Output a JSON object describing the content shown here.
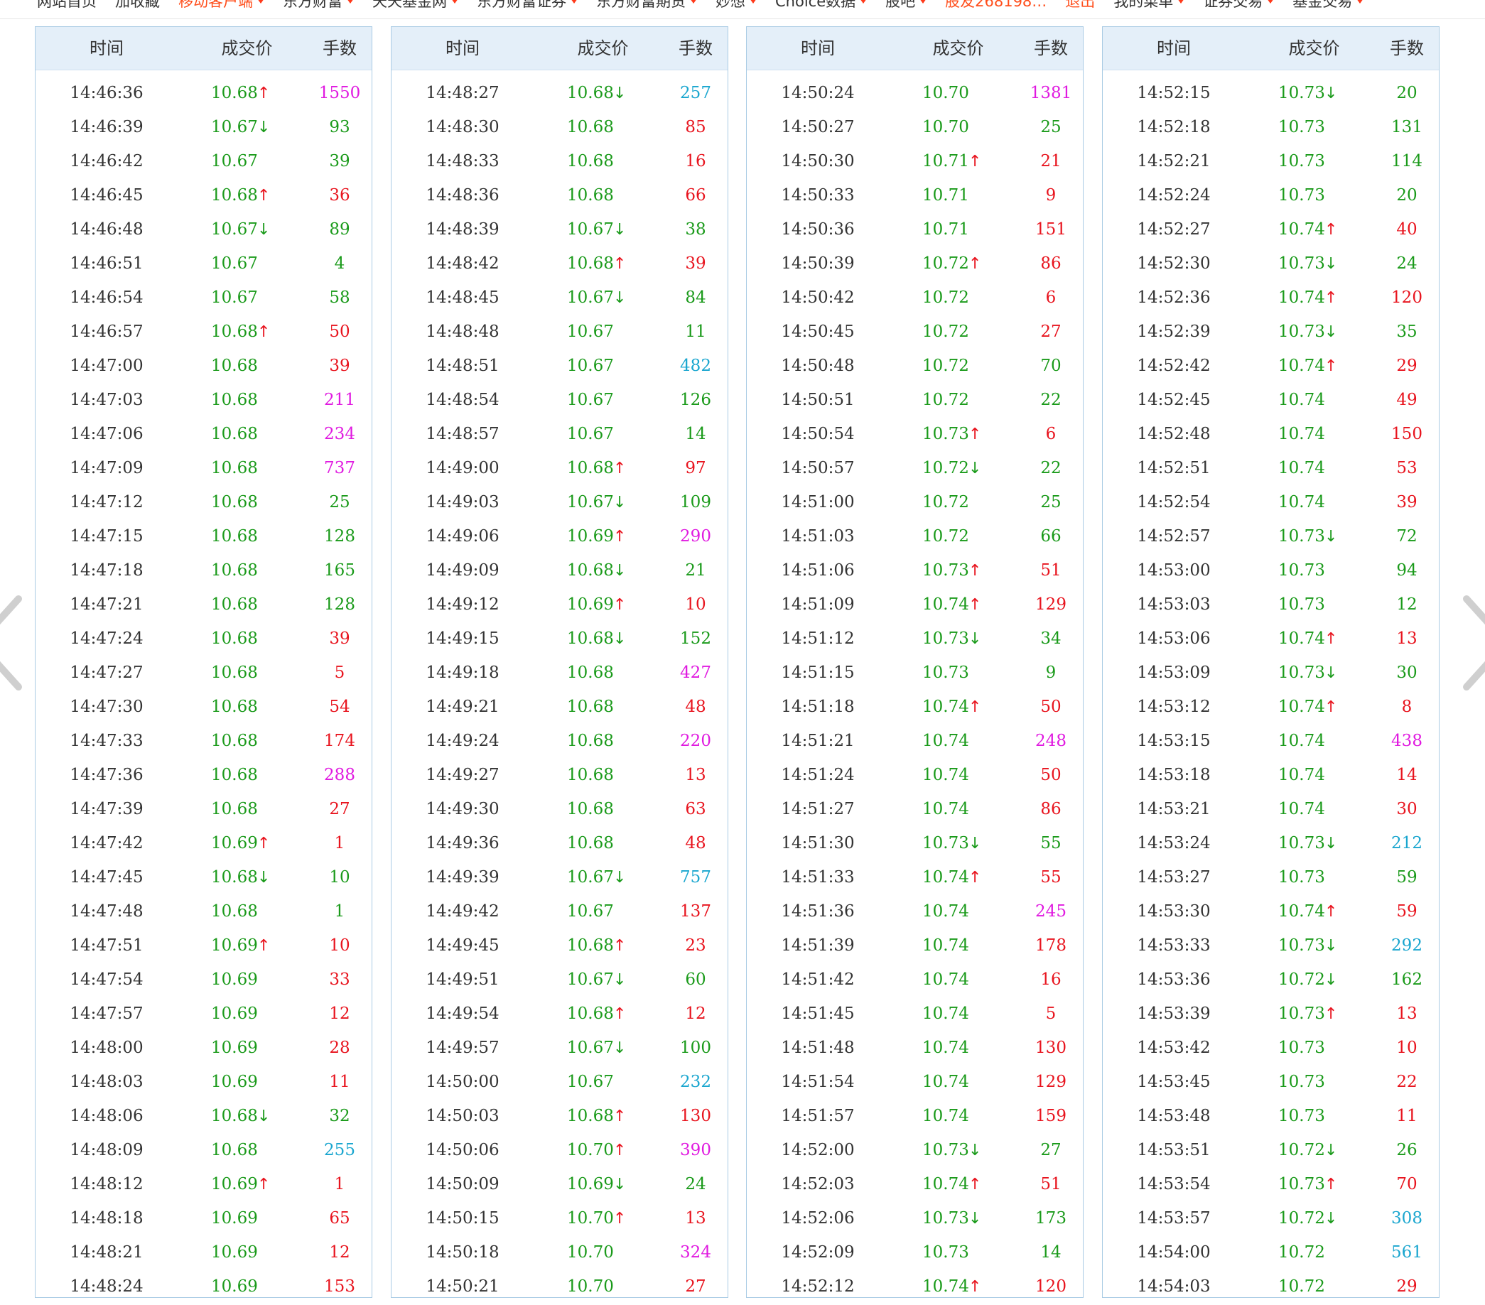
{
  "nav": [
    {
      "label": "网站首页",
      "red": false,
      "caret": false
    },
    {
      "label": "加收藏",
      "red": false,
      "caret": false
    },
    {
      "label": "移动客户端",
      "red": true,
      "caret": true
    },
    {
      "label": "东方财富",
      "red": false,
      "caret": true
    },
    {
      "label": "天天基金网",
      "red": false,
      "caret": true
    },
    {
      "label": "东方财富证券",
      "red": false,
      "caret": true
    },
    {
      "label": "东方财富期货",
      "red": false,
      "caret": true
    },
    {
      "label": "妙想",
      "red": false,
      "caret": true
    },
    {
      "label": "Choice数据",
      "red": false,
      "caret": true
    },
    {
      "label": "股吧",
      "red": false,
      "caret": true
    },
    {
      "label": "股友268198…",
      "red": true,
      "caret": false
    },
    {
      "label": "退出",
      "red": true,
      "caret": false
    },
    {
      "label": "我的菜单",
      "red": false,
      "caret": true
    },
    {
      "label": "证券交易",
      "red": false,
      "caret": true
    },
    {
      "label": "基金交易",
      "red": false,
      "caret": true
    }
  ],
  "headers": {
    "time": "时间",
    "price": "成交价",
    "volume": "手数"
  },
  "panels": [
    {
      "rows": [
        [
          "14:46:36",
          "10.68",
          "up",
          "1550",
          "m"
        ],
        [
          "14:46:39",
          "10.67",
          "down",
          "93",
          "g"
        ],
        [
          "14:46:42",
          "10.67",
          "",
          "39",
          "g"
        ],
        [
          "14:46:45",
          "10.68",
          "up",
          "36",
          "r"
        ],
        [
          "14:46:48",
          "10.67",
          "down",
          "89",
          "g"
        ],
        [
          "14:46:51",
          "10.67",
          "",
          "4",
          "g"
        ],
        [
          "14:46:54",
          "10.67",
          "",
          "58",
          "g"
        ],
        [
          "14:46:57",
          "10.68",
          "up",
          "50",
          "r"
        ],
        [
          "14:47:00",
          "10.68",
          "",
          "39",
          "r"
        ],
        [
          "14:47:03",
          "10.68",
          "",
          "211",
          "m"
        ],
        [
          "14:47:06",
          "10.68",
          "",
          "234",
          "m"
        ],
        [
          "14:47:09",
          "10.68",
          "",
          "737",
          "m"
        ],
        [
          "14:47:12",
          "10.68",
          "",
          "25",
          "g"
        ],
        [
          "14:47:15",
          "10.68",
          "",
          "128",
          "g"
        ],
        [
          "14:47:18",
          "10.68",
          "",
          "165",
          "g"
        ],
        [
          "14:47:21",
          "10.68",
          "",
          "128",
          "g"
        ],
        [
          "14:47:24",
          "10.68",
          "",
          "39",
          "r"
        ],
        [
          "14:47:27",
          "10.68",
          "",
          "5",
          "r"
        ],
        [
          "14:47:30",
          "10.68",
          "",
          "54",
          "r"
        ],
        [
          "14:47:33",
          "10.68",
          "",
          "174",
          "r"
        ],
        [
          "14:47:36",
          "10.68",
          "",
          "288",
          "m"
        ],
        [
          "14:47:39",
          "10.68",
          "",
          "27",
          "r"
        ],
        [
          "14:47:42",
          "10.69",
          "up",
          "1",
          "r"
        ],
        [
          "14:47:45",
          "10.68",
          "down",
          "10",
          "g"
        ],
        [
          "14:47:48",
          "10.68",
          "",
          "1",
          "g"
        ],
        [
          "14:47:51",
          "10.69",
          "up",
          "10",
          "r"
        ],
        [
          "14:47:54",
          "10.69",
          "",
          "33",
          "r"
        ],
        [
          "14:47:57",
          "10.69",
          "",
          "12",
          "r"
        ],
        [
          "14:48:00",
          "10.69",
          "",
          "28",
          "r"
        ],
        [
          "14:48:03",
          "10.69",
          "",
          "11",
          "r"
        ],
        [
          "14:48:06",
          "10.68",
          "down",
          "32",
          "g"
        ],
        [
          "14:48:09",
          "10.68",
          "",
          "255",
          "c"
        ],
        [
          "14:48:12",
          "10.69",
          "up",
          "1",
          "r"
        ],
        [
          "14:48:18",
          "10.69",
          "",
          "65",
          "r"
        ],
        [
          "14:48:21",
          "10.69",
          "",
          "12",
          "r"
        ],
        [
          "14:48:24",
          "10.69",
          "",
          "153",
          "r"
        ]
      ]
    },
    {
      "rows": [
        [
          "14:48:27",
          "10.68",
          "down",
          "257",
          "c"
        ],
        [
          "14:48:30",
          "10.68",
          "",
          "85",
          "r"
        ],
        [
          "14:48:33",
          "10.68",
          "",
          "16",
          "r"
        ],
        [
          "14:48:36",
          "10.68",
          "",
          "66",
          "r"
        ],
        [
          "14:48:39",
          "10.67",
          "down",
          "38",
          "g"
        ],
        [
          "14:48:42",
          "10.68",
          "up",
          "39",
          "r"
        ],
        [
          "14:48:45",
          "10.67",
          "down",
          "84",
          "g"
        ],
        [
          "14:48:48",
          "10.67",
          "",
          "11",
          "g"
        ],
        [
          "14:48:51",
          "10.67",
          "",
          "482",
          "c"
        ],
        [
          "14:48:54",
          "10.67",
          "",
          "126",
          "g"
        ],
        [
          "14:48:57",
          "10.67",
          "",
          "14",
          "g"
        ],
        [
          "14:49:00",
          "10.68",
          "up",
          "97",
          "r"
        ],
        [
          "14:49:03",
          "10.67",
          "down",
          "109",
          "g"
        ],
        [
          "14:49:06",
          "10.69",
          "up",
          "290",
          "m"
        ],
        [
          "14:49:09",
          "10.68",
          "down",
          "21",
          "g"
        ],
        [
          "14:49:12",
          "10.69",
          "up",
          "10",
          "r"
        ],
        [
          "14:49:15",
          "10.68",
          "down",
          "152",
          "g"
        ],
        [
          "14:49:18",
          "10.68",
          "",
          "427",
          "m"
        ],
        [
          "14:49:21",
          "10.68",
          "",
          "48",
          "r"
        ],
        [
          "14:49:24",
          "10.68",
          "",
          "220",
          "m"
        ],
        [
          "14:49:27",
          "10.68",
          "",
          "13",
          "r"
        ],
        [
          "14:49:30",
          "10.68",
          "",
          "63",
          "r"
        ],
        [
          "14:49:36",
          "10.68",
          "",
          "48",
          "r"
        ],
        [
          "14:49:39",
          "10.67",
          "down",
          "757",
          "c"
        ],
        [
          "14:49:42",
          "10.67",
          "",
          "137",
          "r"
        ],
        [
          "14:49:45",
          "10.68",
          "up",
          "23",
          "r"
        ],
        [
          "14:49:51",
          "10.67",
          "down",
          "60",
          "g"
        ],
        [
          "14:49:54",
          "10.68",
          "up",
          "12",
          "r"
        ],
        [
          "14:49:57",
          "10.67",
          "down",
          "100",
          "g"
        ],
        [
          "14:50:00",
          "10.67",
          "",
          "232",
          "c"
        ],
        [
          "14:50:03",
          "10.68",
          "up",
          "130",
          "r"
        ],
        [
          "14:50:06",
          "10.70",
          "up",
          "390",
          "m"
        ],
        [
          "14:50:09",
          "10.69",
          "down",
          "24",
          "g"
        ],
        [
          "14:50:15",
          "10.70",
          "up",
          "13",
          "r"
        ],
        [
          "14:50:18",
          "10.70",
          "",
          "324",
          "m"
        ],
        [
          "14:50:21",
          "10.70",
          "",
          "27",
          "r"
        ]
      ]
    },
    {
      "rows": [
        [
          "14:50:24",
          "10.70",
          "",
          "1381",
          "m"
        ],
        [
          "14:50:27",
          "10.70",
          "",
          "25",
          "g"
        ],
        [
          "14:50:30",
          "10.71",
          "up",
          "21",
          "r"
        ],
        [
          "14:50:33",
          "10.71",
          "",
          "9",
          "r"
        ],
        [
          "14:50:36",
          "10.71",
          "",
          "151",
          "r"
        ],
        [
          "14:50:39",
          "10.72",
          "up",
          "86",
          "r"
        ],
        [
          "14:50:42",
          "10.72",
          "",
          "6",
          "r"
        ],
        [
          "14:50:45",
          "10.72",
          "",
          "27",
          "r"
        ],
        [
          "14:50:48",
          "10.72",
          "",
          "70",
          "g"
        ],
        [
          "14:50:51",
          "10.72",
          "",
          "22",
          "g"
        ],
        [
          "14:50:54",
          "10.73",
          "up",
          "6",
          "r"
        ],
        [
          "14:50:57",
          "10.72",
          "down",
          "22",
          "g"
        ],
        [
          "14:51:00",
          "10.72",
          "",
          "25",
          "g"
        ],
        [
          "14:51:03",
          "10.72",
          "",
          "66",
          "g"
        ],
        [
          "14:51:06",
          "10.73",
          "up",
          "51",
          "r"
        ],
        [
          "14:51:09",
          "10.74",
          "up",
          "129",
          "r"
        ],
        [
          "14:51:12",
          "10.73",
          "down",
          "34",
          "g"
        ],
        [
          "14:51:15",
          "10.73",
          "",
          "9",
          "g"
        ],
        [
          "14:51:18",
          "10.74",
          "up",
          "50",
          "r"
        ],
        [
          "14:51:21",
          "10.74",
          "",
          "248",
          "m"
        ],
        [
          "14:51:24",
          "10.74",
          "",
          "50",
          "r"
        ],
        [
          "14:51:27",
          "10.74",
          "",
          "86",
          "r"
        ],
        [
          "14:51:30",
          "10.73",
          "down",
          "55",
          "g"
        ],
        [
          "14:51:33",
          "10.74",
          "up",
          "55",
          "r"
        ],
        [
          "14:51:36",
          "10.74",
          "",
          "245",
          "m"
        ],
        [
          "14:51:39",
          "10.74",
          "",
          "178",
          "r"
        ],
        [
          "14:51:42",
          "10.74",
          "",
          "16",
          "r"
        ],
        [
          "14:51:45",
          "10.74",
          "",
          "5",
          "r"
        ],
        [
          "14:51:48",
          "10.74",
          "",
          "130",
          "r"
        ],
        [
          "14:51:54",
          "10.74",
          "",
          "129",
          "r"
        ],
        [
          "14:51:57",
          "10.74",
          "",
          "159",
          "r"
        ],
        [
          "14:52:00",
          "10.73",
          "down",
          "27",
          "g"
        ],
        [
          "14:52:03",
          "10.74",
          "up",
          "51",
          "r"
        ],
        [
          "14:52:06",
          "10.73",
          "down",
          "173",
          "g"
        ],
        [
          "14:52:09",
          "10.73",
          "",
          "14",
          "g"
        ],
        [
          "14:52:12",
          "10.74",
          "up",
          "120",
          "r"
        ]
      ]
    },
    {
      "rows": [
        [
          "14:52:15",
          "10.73",
          "down",
          "20",
          "g"
        ],
        [
          "14:52:18",
          "10.73",
          "",
          "131",
          "g"
        ],
        [
          "14:52:21",
          "10.73",
          "",
          "114",
          "g"
        ],
        [
          "14:52:24",
          "10.73",
          "",
          "20",
          "g"
        ],
        [
          "14:52:27",
          "10.74",
          "up",
          "40",
          "r"
        ],
        [
          "14:52:30",
          "10.73",
          "down",
          "24",
          "g"
        ],
        [
          "14:52:36",
          "10.74",
          "up",
          "120",
          "r"
        ],
        [
          "14:52:39",
          "10.73",
          "down",
          "35",
          "g"
        ],
        [
          "14:52:42",
          "10.74",
          "up",
          "29",
          "r"
        ],
        [
          "14:52:45",
          "10.74",
          "",
          "49",
          "r"
        ],
        [
          "14:52:48",
          "10.74",
          "",
          "150",
          "r"
        ],
        [
          "14:52:51",
          "10.74",
          "",
          "53",
          "r"
        ],
        [
          "14:52:54",
          "10.74",
          "",
          "39",
          "r"
        ],
        [
          "14:52:57",
          "10.73",
          "down",
          "72",
          "g"
        ],
        [
          "14:53:00",
          "10.73",
          "",
          "94",
          "g"
        ],
        [
          "14:53:03",
          "10.73",
          "",
          "12",
          "g"
        ],
        [
          "14:53:06",
          "10.74",
          "up",
          "13",
          "r"
        ],
        [
          "14:53:09",
          "10.73",
          "down",
          "30",
          "g"
        ],
        [
          "14:53:12",
          "10.74",
          "up",
          "8",
          "r"
        ],
        [
          "14:53:15",
          "10.74",
          "",
          "438",
          "m"
        ],
        [
          "14:53:18",
          "10.74",
          "",
          "14",
          "r"
        ],
        [
          "14:53:21",
          "10.74",
          "",
          "30",
          "r"
        ],
        [
          "14:53:24",
          "10.73",
          "down",
          "212",
          "c"
        ],
        [
          "14:53:27",
          "10.73",
          "",
          "59",
          "g"
        ],
        [
          "14:53:30",
          "10.74",
          "up",
          "59",
          "r"
        ],
        [
          "14:53:33",
          "10.73",
          "down",
          "292",
          "c"
        ],
        [
          "14:53:36",
          "10.72",
          "down",
          "162",
          "g"
        ],
        [
          "14:53:39",
          "10.73",
          "up",
          "13",
          "r"
        ],
        [
          "14:53:42",
          "10.73",
          "",
          "10",
          "r"
        ],
        [
          "14:53:45",
          "10.73",
          "",
          "22",
          "r"
        ],
        [
          "14:53:48",
          "10.73",
          "",
          "11",
          "r"
        ],
        [
          "14:53:51",
          "10.72",
          "down",
          "26",
          "g"
        ],
        [
          "14:53:54",
          "10.73",
          "up",
          "70",
          "r"
        ],
        [
          "14:53:57",
          "10.72",
          "down",
          "308",
          "c"
        ],
        [
          "14:54:00",
          "10.72",
          "",
          "561",
          "c"
        ],
        [
          "14:54:03",
          "10.72",
          "",
          "29",
          "r"
        ]
      ]
    }
  ],
  "icons": {
    "left": "chevron-left-icon",
    "right": "chevron-right-icon",
    "up": "arrow-up-icon",
    "down": "arrow-down-icon"
  },
  "colors": {
    "up": "#e8141e",
    "down": "#1a9a1a",
    "large": "#e01ae0",
    "large_sell": "#1aa6cf",
    "header_bg": "#e4eff9",
    "border": "#a9cbe4"
  }
}
